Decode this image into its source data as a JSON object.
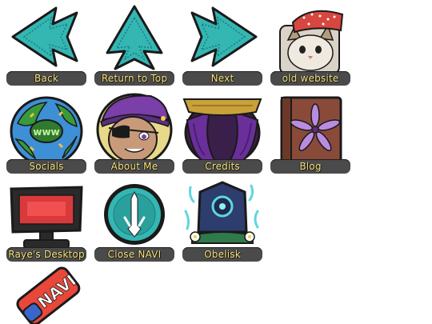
{
  "nav": {
    "items": [
      {
        "label": "Back",
        "icon": "arrow-left-icon"
      },
      {
        "label": "Return to Top",
        "icon": "arrow-up-icon"
      },
      {
        "label": "Next",
        "icon": "arrow-right-icon"
      },
      {
        "label": "old website",
        "icon": "cat-with-hat-icon"
      },
      {
        "label": "Socials",
        "icon": "globe-icon"
      },
      {
        "label": "About Me",
        "icon": "avatar-icon"
      },
      {
        "label": "Credits",
        "icon": "curtain-icon"
      },
      {
        "label": "Blog",
        "icon": "book-icon"
      },
      {
        "label": "Raye's Desktop",
        "icon": "monitor-icon"
      },
      {
        "label": "Close NAVI",
        "icon": "close-navi-icon"
      },
      {
        "label": "Obelisk",
        "icon": "obelisk-icon"
      }
    ],
    "badge": {
      "text": "NAVI",
      "icon": "navi-device-icon"
    }
  },
  "colors": {
    "label_bg": "#4a4a4a",
    "label_text": "#f6e37a",
    "arrow_teal": "#34b6b3",
    "outline": "#1a1a1a"
  }
}
